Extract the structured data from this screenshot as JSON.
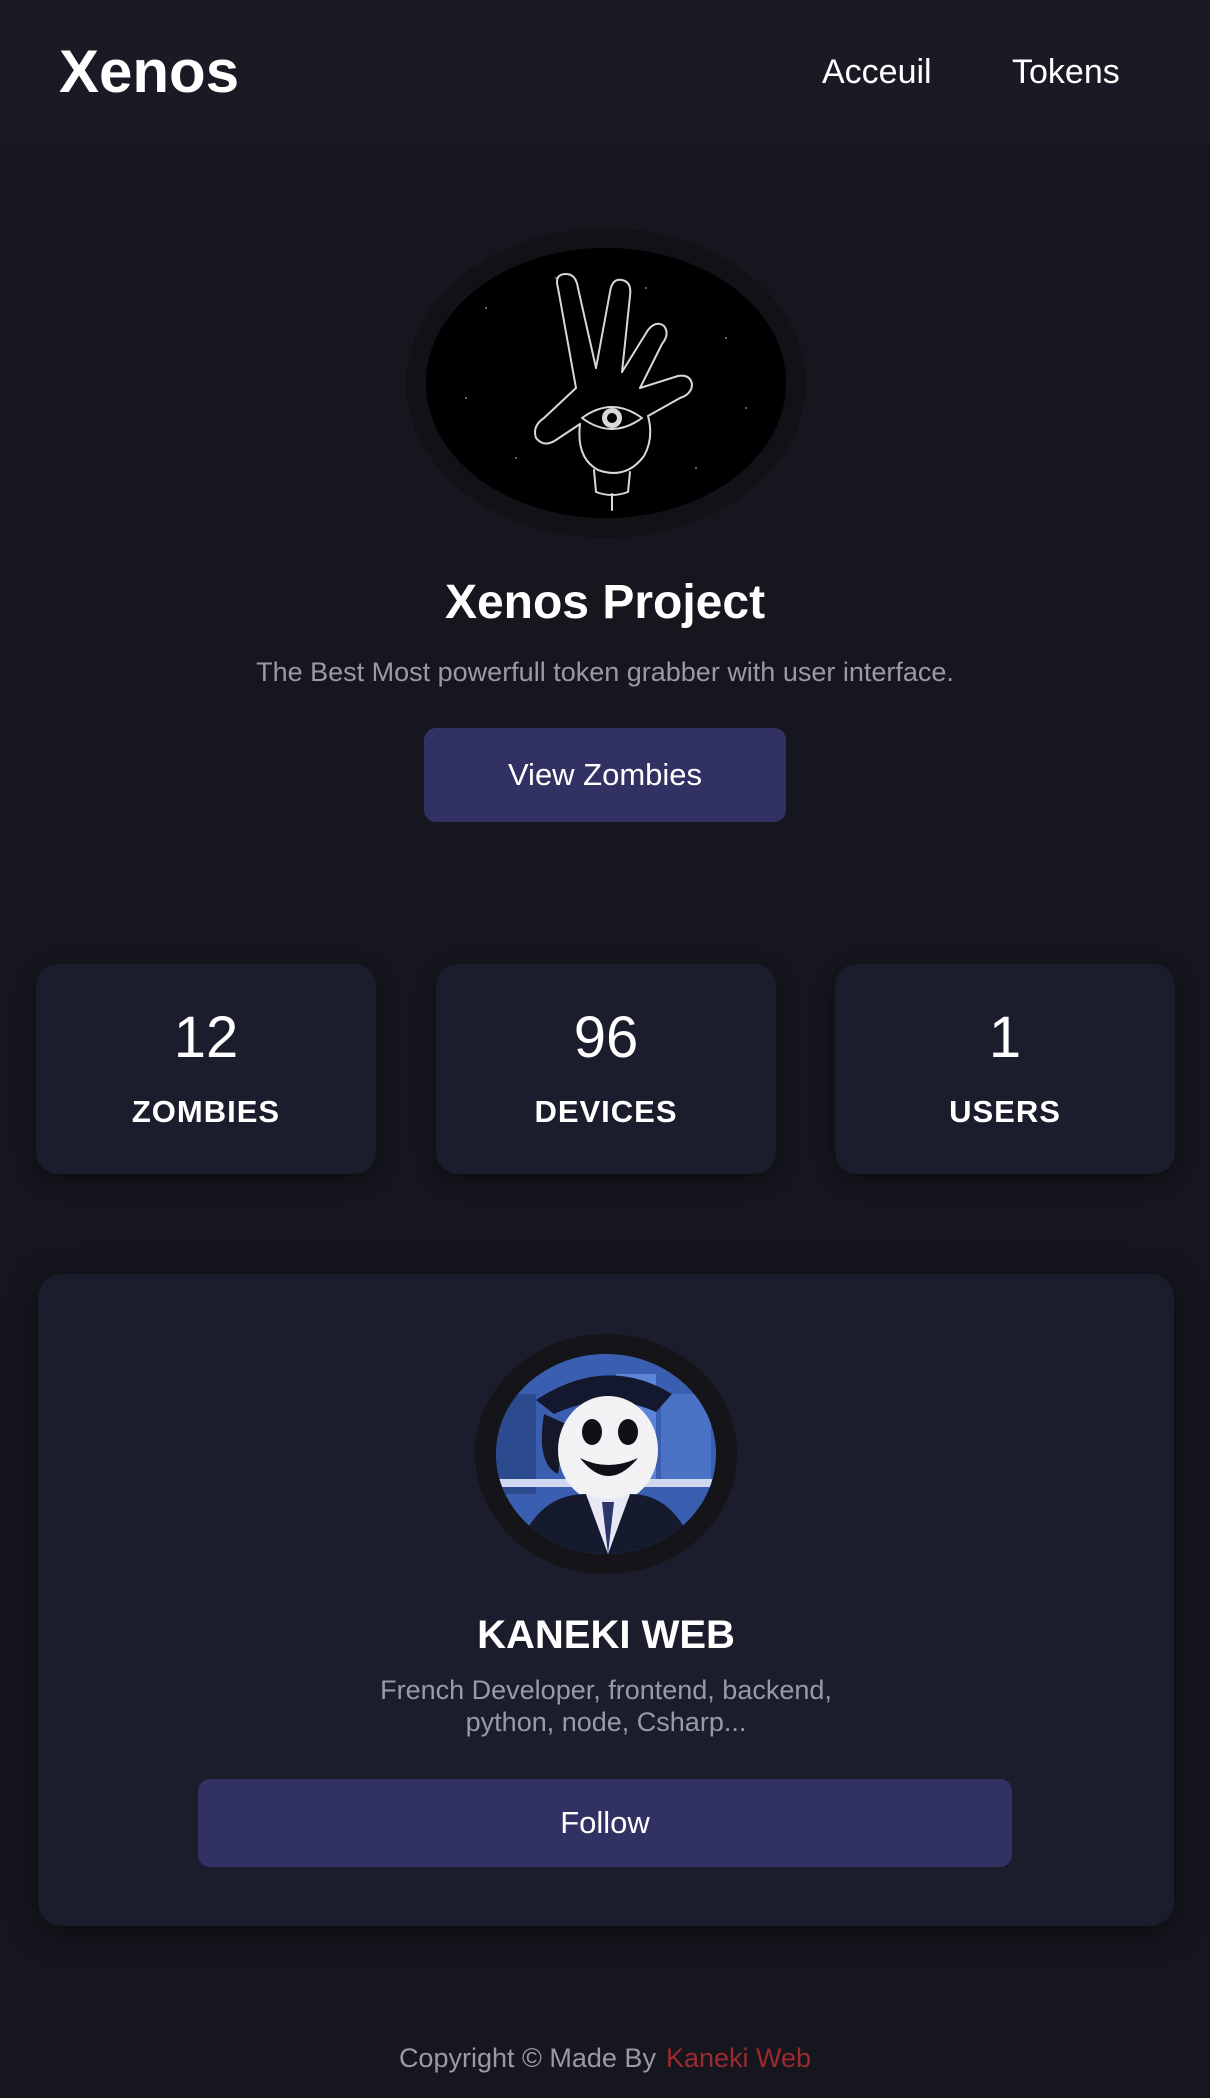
{
  "header": {
    "brand": "Xenos",
    "nav": {
      "home": "Acceuil",
      "tokens": "Tokens"
    }
  },
  "hero": {
    "logo_icon": "eye-hand-icon",
    "title": "Xenos Project",
    "subtitle": "The Best Most powerfull token grabber with user interface.",
    "button_label": "View Zombies"
  },
  "stats": [
    {
      "value": "12",
      "label": "ZOMBIES"
    },
    {
      "value": "96",
      "label": "DEVICES"
    },
    {
      "value": "1",
      "label": "USERS"
    }
  ],
  "profile": {
    "name": "KANEKI WEB",
    "bio": "French Developer, frontend, backend, python, node, Csharp...",
    "follow_label": "Follow"
  },
  "footer": {
    "copyright": "Copyright © Made By",
    "author": "Kaneki Web"
  },
  "colors": {
    "background": "#16161f",
    "card": "#1b1c2c",
    "button": "#313263",
    "muted_text": "#9a9aa6",
    "footer_link": "#9c2a2f"
  }
}
